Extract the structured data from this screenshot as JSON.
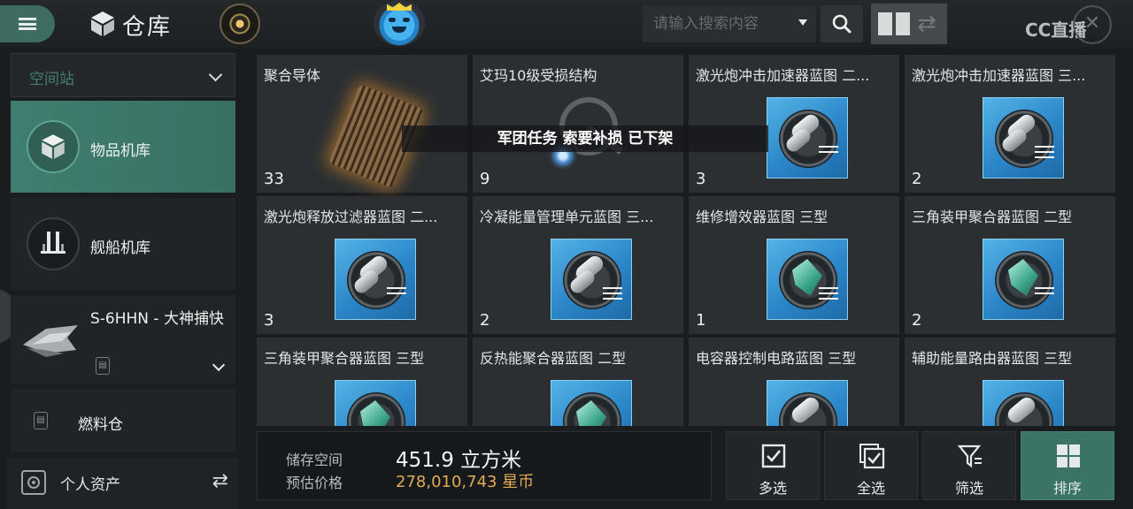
{
  "header": {
    "title": "仓库",
    "search_placeholder": "请输入搜索内容",
    "watermark": "CC直播"
  },
  "sidebar": {
    "station_select": "空间站",
    "items": [
      {
        "label": "物品机库",
        "active": true
      },
      {
        "label": "舰船机库",
        "active": false
      },
      {
        "label": "S-6HHN - 大神捕快",
        "active": false
      },
      {
        "label": "燃料仓",
        "active": false
      }
    ],
    "personal_assets": "个人资产"
  },
  "banner": "军团任务 索要补损 已下架",
  "items": [
    {
      "name": "聚合导体",
      "qty": "33"
    },
    {
      "name": "艾玛10级受损结构",
      "qty": "9"
    },
    {
      "name": "激光炮冲击加速器蓝图 二...",
      "qty": "3"
    },
    {
      "name": "激光炮冲击加速器蓝图 三...",
      "qty": "2"
    },
    {
      "name": "激光炮释放过滤器蓝图 二...",
      "qty": "3"
    },
    {
      "name": "冷凝能量管理单元蓝图 三...",
      "qty": "2"
    },
    {
      "name": "维修增效器蓝图 三型",
      "qty": "1"
    },
    {
      "name": "三角装甲聚合器蓝图 二型",
      "qty": "2"
    },
    {
      "name": "三角装甲聚合器蓝图 三型",
      "qty": ""
    },
    {
      "name": "反热能聚合器蓝图 二型",
      "qty": ""
    },
    {
      "name": "电容器控制电路蓝图 三型",
      "qty": ""
    },
    {
      "name": "辅助能量路由器蓝图 三型",
      "qty": ""
    }
  ],
  "storage": {
    "space_label": "储存空间",
    "space_value": "451.9 立方米",
    "price_label": "预估价格",
    "price_value": "278,010,743 星币"
  },
  "actions": [
    {
      "label": "多选"
    },
    {
      "label": "全选"
    },
    {
      "label": "筛选"
    },
    {
      "label": "排序"
    }
  ],
  "colors": {
    "accent": "#3b7466",
    "price": "#e3a955",
    "station_text": "#43816f"
  }
}
